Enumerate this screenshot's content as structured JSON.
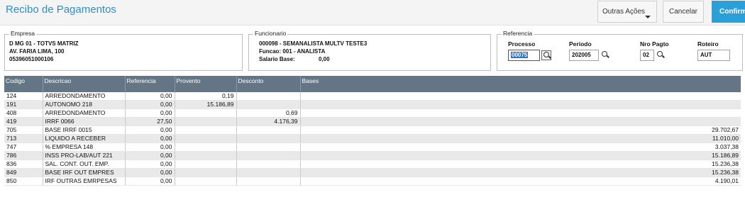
{
  "header": {
    "title": "Recibo de Pagamentos",
    "outras_acoes": "Outras Ações",
    "cancelar": "Cancelar",
    "confirmar": "Confirm"
  },
  "empresa": {
    "legend": "Empresa",
    "line1": "D MG 01  - TOTVS MATRIZ",
    "line2": "AV. FARIA LIMA, 100",
    "line3": "05396051000106"
  },
  "funcionario": {
    "legend": "Funcionario",
    "line1": "000098 - SEMANALISTA MULTV TESTE3",
    "line2": "Funcao: 001   - ANALISTA",
    "salario_label": "Salario Base:",
    "salario_value": "0,00"
  },
  "referencia": {
    "legend": "Referencia",
    "processo_label": "Processo",
    "processo_value": "00075",
    "periodo_label": "Periodo",
    "periodo_value": "202005",
    "nro_pagto_label": "Nro Pagto",
    "nro_pagto_value": "02",
    "roteiro_label": "Roteiro",
    "roteiro_value": "AUT"
  },
  "table": {
    "columns": [
      "Codigo",
      "Descricao",
      "Referencia",
      "Provento",
      "Desconto",
      "Bases"
    ],
    "rows": [
      [
        "124",
        "ARREDONDAMENTO",
        "0,00",
        "0,19",
        "",
        ""
      ],
      [
        "191",
        "AUTONOMO 218",
        "0,00",
        "15.186,89",
        "",
        ""
      ],
      [
        "408",
        "ARREDONDAMENTO",
        "0,00",
        "",
        "0,69",
        ""
      ],
      [
        "419",
        "IRRF 0066",
        "27,50",
        "",
        "4.176,39",
        ""
      ],
      [
        "705",
        "BASE IRRF 0015",
        "0,00",
        "",
        "",
        "29.702,67"
      ],
      [
        "713",
        "LIQUIDO A RECEBER",
        "0,00",
        "",
        "",
        "11.010,00"
      ],
      [
        "747",
        "% EMPRESA  148",
        "0,00",
        "",
        "",
        "3.037,38"
      ],
      [
        "786",
        "INSS PRO-LAB/AUT 221",
        "0,00",
        "",
        "",
        "15.186,89"
      ],
      [
        "836",
        "SAL. CONT. OUT. EMP.",
        "0,00",
        "",
        "",
        "15.236,38"
      ],
      [
        "849",
        "BASE IRF OUT EMPRES",
        "0,00",
        "",
        "",
        "15.236,38"
      ],
      [
        "850",
        "IRF OUTRAS EMRPESAS",
        "0,00",
        "",
        "",
        "4.190,01"
      ]
    ]
  },
  "colors": {
    "title": "#2b8fcf",
    "confirm_button": "#29a1d8",
    "grid_header": "#647686",
    "row_alt": "#e9e9e9"
  }
}
